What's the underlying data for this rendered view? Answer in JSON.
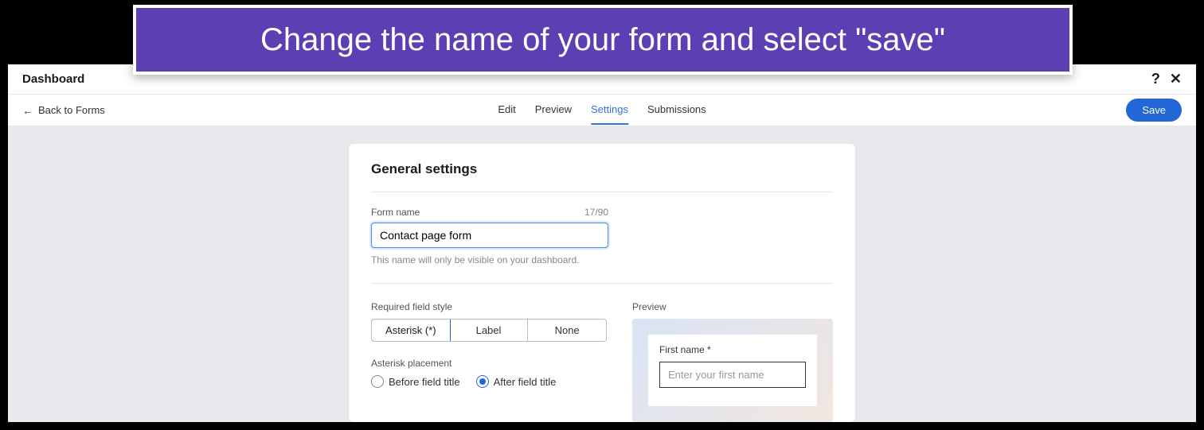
{
  "banner": {
    "text": "Change the name of your form and select \"save\""
  },
  "header": {
    "title": "Dashboard",
    "help_icon": "?",
    "close_icon": "✕"
  },
  "toolbar": {
    "back_label": "Back to Forms",
    "save_label": "Save"
  },
  "tabs": {
    "edit": "Edit",
    "preview": "Preview",
    "settings": "Settings",
    "submissions": "Submissions"
  },
  "panel": {
    "title": "General settings",
    "form_name_label": "Form name",
    "char_count": "17/90",
    "form_name_value": "Contact page form",
    "help_text": "This name will only be visible on your dashboard.",
    "required_style_label": "Required field style",
    "segments": {
      "asterisk": "Asterisk (*)",
      "label": "Label",
      "none": "None"
    },
    "placement_label": "Asterisk placement",
    "placement": {
      "before": "Before field title",
      "after": "After field title"
    },
    "preview_label": "Preview",
    "preview_field_label": "First name *",
    "preview_placeholder": "Enter your first name"
  }
}
